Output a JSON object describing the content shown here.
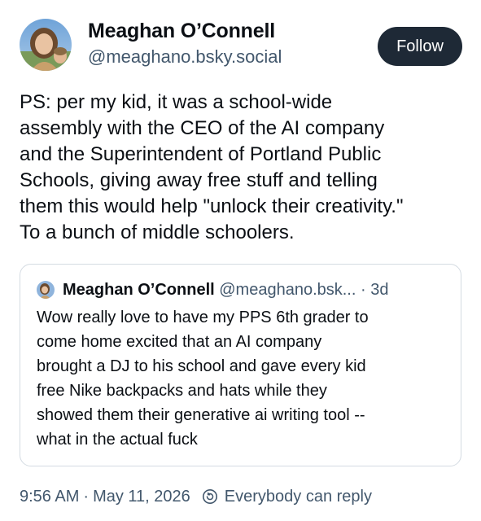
{
  "author": {
    "name": "Meaghan O’Connell",
    "handle": "@meaghano.bsky.social",
    "avatar_icon": "user-avatar-photo"
  },
  "follow_button": {
    "label": "Follow",
    "bg_color": "#1e2936"
  },
  "post": {
    "lines": [
      "PS: per my kid, it was a school-wide",
      "assembly with the CEO of the AI company",
      "and the Superintendent of Portland Public",
      "Schools, giving away free stuff and telling",
      "them this would help \"unlock their creativity.\"",
      "To a bunch of middle schoolers."
    ]
  },
  "quote": {
    "author_name": "Meaghan O’Connell",
    "author_handle": "@meaghano.bsk...",
    "separator": "·",
    "time": "3d",
    "lines": [
      "Wow really love to have my PPS 6th grader to",
      "come home excited that an AI company",
      "brought a DJ to his school and gave every kid",
      "free Nike backpacks and hats while they",
      "showed them their generative ai writing tool --",
      "what in the actual fuck"
    ]
  },
  "meta": {
    "time": "9:56 AM",
    "separator": "·",
    "date": "May 11, 2026",
    "reply_icon": "reply-settings-icon",
    "reply_setting": "Everybody can reply"
  }
}
